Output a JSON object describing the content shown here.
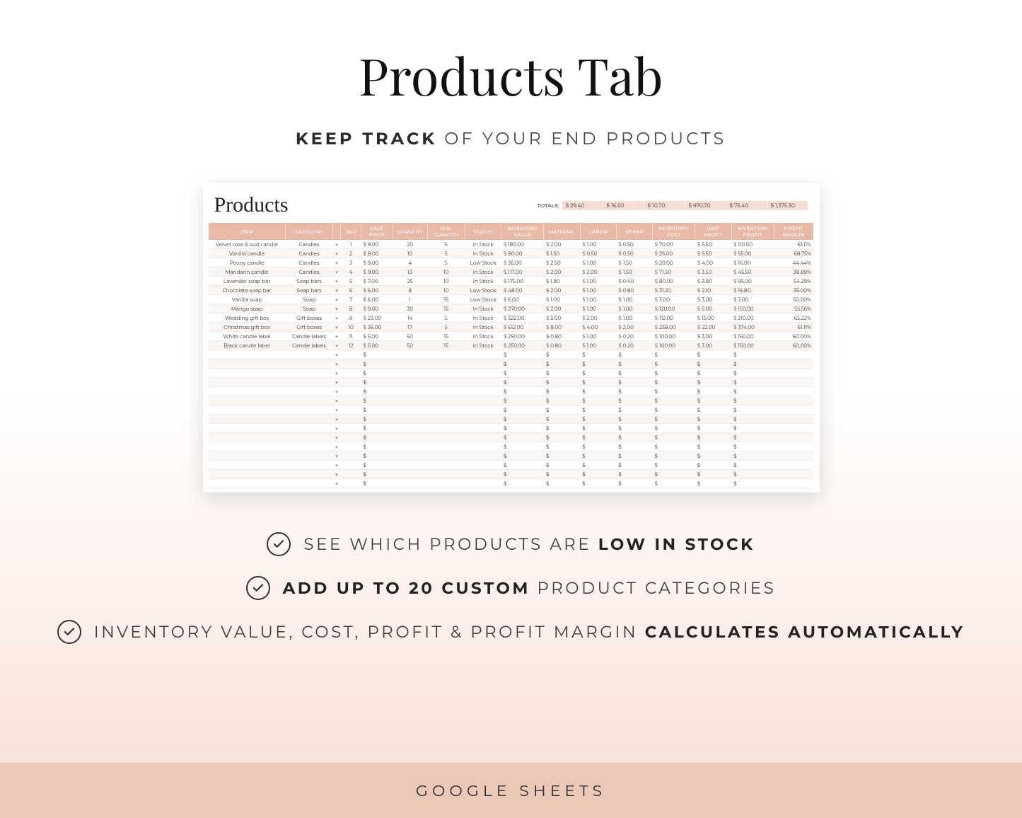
{
  "title": "Products Tab",
  "subtitle_bold": "KEEP TRACK",
  "subtitle_rest": " OF YOUR END PRODUCTS",
  "sheet_title": "Products",
  "totals_label": "TOTALS:",
  "totals": [
    "$  29.40",
    "$   16.50",
    "$   10.70",
    "$  970.70",
    "$   75.40",
    "$ 1,375.30"
  ],
  "columns": [
    "ITEM",
    "CATEGORY",
    "",
    "SKU",
    "SALE PRICE",
    "QUANTITY",
    "MIN. QUANTITY",
    "STATUS",
    "INVENTORY VALUE",
    "MATERIAL",
    "LABOR",
    "OTHER",
    "INVENTORY COST",
    "UNIT PROFIT",
    "INVENTORY PROFIT",
    "PROFIT MARGIN"
  ],
  "rows": [
    {
      "item": "Velvet rose & oud candle",
      "cat": "Candles",
      "sku": "1",
      "price": "9.00",
      "qty": "20",
      "min": "5",
      "status": "In Stock",
      "inv_val": "180.00",
      "mat": "2.00",
      "lab": "1.00",
      "oth": "0.50",
      "inv_cost": "70.00",
      "uprof": "5.50",
      "iprof": "110.00",
      "margin": "61.11%"
    },
    {
      "item": "Vanilla candle",
      "cat": "Candles",
      "sku": "2",
      "price": "8.00",
      "qty": "10",
      "min": "5",
      "status": "In Stock",
      "inv_val": "80.00",
      "mat": "1.50",
      "lab": "0.50",
      "oth": "0.50",
      "inv_cost": "25.00",
      "uprof": "5.50",
      "iprof": "55.00",
      "margin": "68.75%"
    },
    {
      "item": "Peony candle",
      "cat": "Candles",
      "sku": "3",
      "price": "9.00",
      "qty": "4",
      "min": "5",
      "status": "Low Stock",
      "inv_val": "36.00",
      "mat": "2.50",
      "lab": "1.00",
      "oth": "1.50",
      "inv_cost": "20.00",
      "uprof": "4.00",
      "iprof": "16.00",
      "margin": "44.44%"
    },
    {
      "item": "Mandarin candle",
      "cat": "Candles",
      "sku": "4",
      "price": "9.00",
      "qty": "13",
      "min": "10",
      "status": "In Stock",
      "inv_val": "117.00",
      "mat": "2.00",
      "lab": "2.00",
      "oth": "1.50",
      "inv_cost": "71.50",
      "uprof": "3.50",
      "iprof": "45.50",
      "margin": "38.89%"
    },
    {
      "item": "Lavender soap bar",
      "cat": "Soap bars",
      "sku": "5",
      "price": "7.00",
      "qty": "25",
      "min": "10",
      "status": "In Stock",
      "inv_val": "175.00",
      "mat": "1.80",
      "lab": "1.00",
      "oth": "0.40",
      "inv_cost": "80.00",
      "uprof": "3.80",
      "iprof": "95.00",
      "margin": "54.29%"
    },
    {
      "item": "Chocolate soap bar",
      "cat": "Soap bars",
      "sku": "6",
      "price": "6.00",
      "qty": "8",
      "min": "10",
      "status": "Low Stock",
      "inv_val": "48.00",
      "mat": "2.00",
      "lab": "1.00",
      "oth": "0.90",
      "inv_cost": "31.20",
      "uprof": "2.10",
      "iprof": "16.80",
      "margin": "35.00%"
    },
    {
      "item": "Vanilla soap",
      "cat": "Soap",
      "sku": "7",
      "price": "6.00",
      "qty": "1",
      "min": "15",
      "status": "Low Stock",
      "inv_val": "6.00",
      "mat": "1.00",
      "lab": "1.00",
      "oth": "1.00",
      "inv_cost": "3.00",
      "uprof": "3.00",
      "iprof": "3.00",
      "margin": "50.00%"
    },
    {
      "item": "Mango soap",
      "cat": "Soap",
      "sku": "8",
      "price": "9.00",
      "qty": "30",
      "min": "15",
      "status": "In Stock",
      "inv_val": "270.00",
      "mat": "2.00",
      "lab": "1.00",
      "oth": "1.00",
      "inv_cost": "120.00",
      "uprof": "5.00",
      "iprof": "150.00",
      "margin": "55.56%"
    },
    {
      "item": "Wedding gift box",
      "cat": "Gift boxes",
      "sku": "9",
      "price": "23.00",
      "qty": "14",
      "min": "5",
      "status": "In Stock",
      "inv_val": "322.00",
      "mat": "5.00",
      "lab": "2.00",
      "oth": "1.00",
      "inv_cost": "112.00",
      "uprof": "15.00",
      "iprof": "210.00",
      "margin": "65.22%"
    },
    {
      "item": "Christmas gift box",
      "cat": "Gift boxes",
      "sku": "10",
      "price": "36.00",
      "qty": "17",
      "min": "5",
      "status": "In Stock",
      "inv_val": "612.00",
      "mat": "8.00",
      "lab": "4.00",
      "oth": "2.00",
      "inv_cost": "238.00",
      "uprof": "22.00",
      "iprof": "374.00",
      "margin": "61.11%"
    },
    {
      "item": "White candle label",
      "cat": "Candle labels",
      "sku": "11",
      "price": "5.00",
      "qty": "50",
      "min": "15",
      "status": "In Stock",
      "inv_val": "250.00",
      "mat": "0.80",
      "lab": "1.00",
      "oth": "0.20",
      "inv_cost": "100.00",
      "uprof": "3.00",
      "iprof": "150.00",
      "margin": "60.00%"
    },
    {
      "item": "Black candle label",
      "cat": "Candle labels",
      "sku": "12",
      "price": "5.00",
      "qty": "50",
      "min": "15",
      "status": "In Stock",
      "inv_val": "250.00",
      "mat": "0.80",
      "lab": "1.00",
      "oth": "0.20",
      "inv_cost": "100.00",
      "uprof": "3.00",
      "iprof": "150.00",
      "margin": "60.00%"
    }
  ],
  "empty_rows": 15,
  "features": [
    {
      "pre": "SEE WHICH PRODUCTS ARE ",
      "bold": "LOW IN STOCK",
      "post": ""
    },
    {
      "pre": "",
      "bold": "ADD UP TO 20 CUSTOM",
      "post": " PRODUCT CATEGORIES"
    },
    {
      "pre": "INVENTORY VALUE, COST, PROFIT & PROFIT MARGIN ",
      "bold": "CALCULATES AUTOMATICALLY",
      "post": ""
    }
  ],
  "footer": "GOOGLE SHEETS",
  "dd": "▾"
}
